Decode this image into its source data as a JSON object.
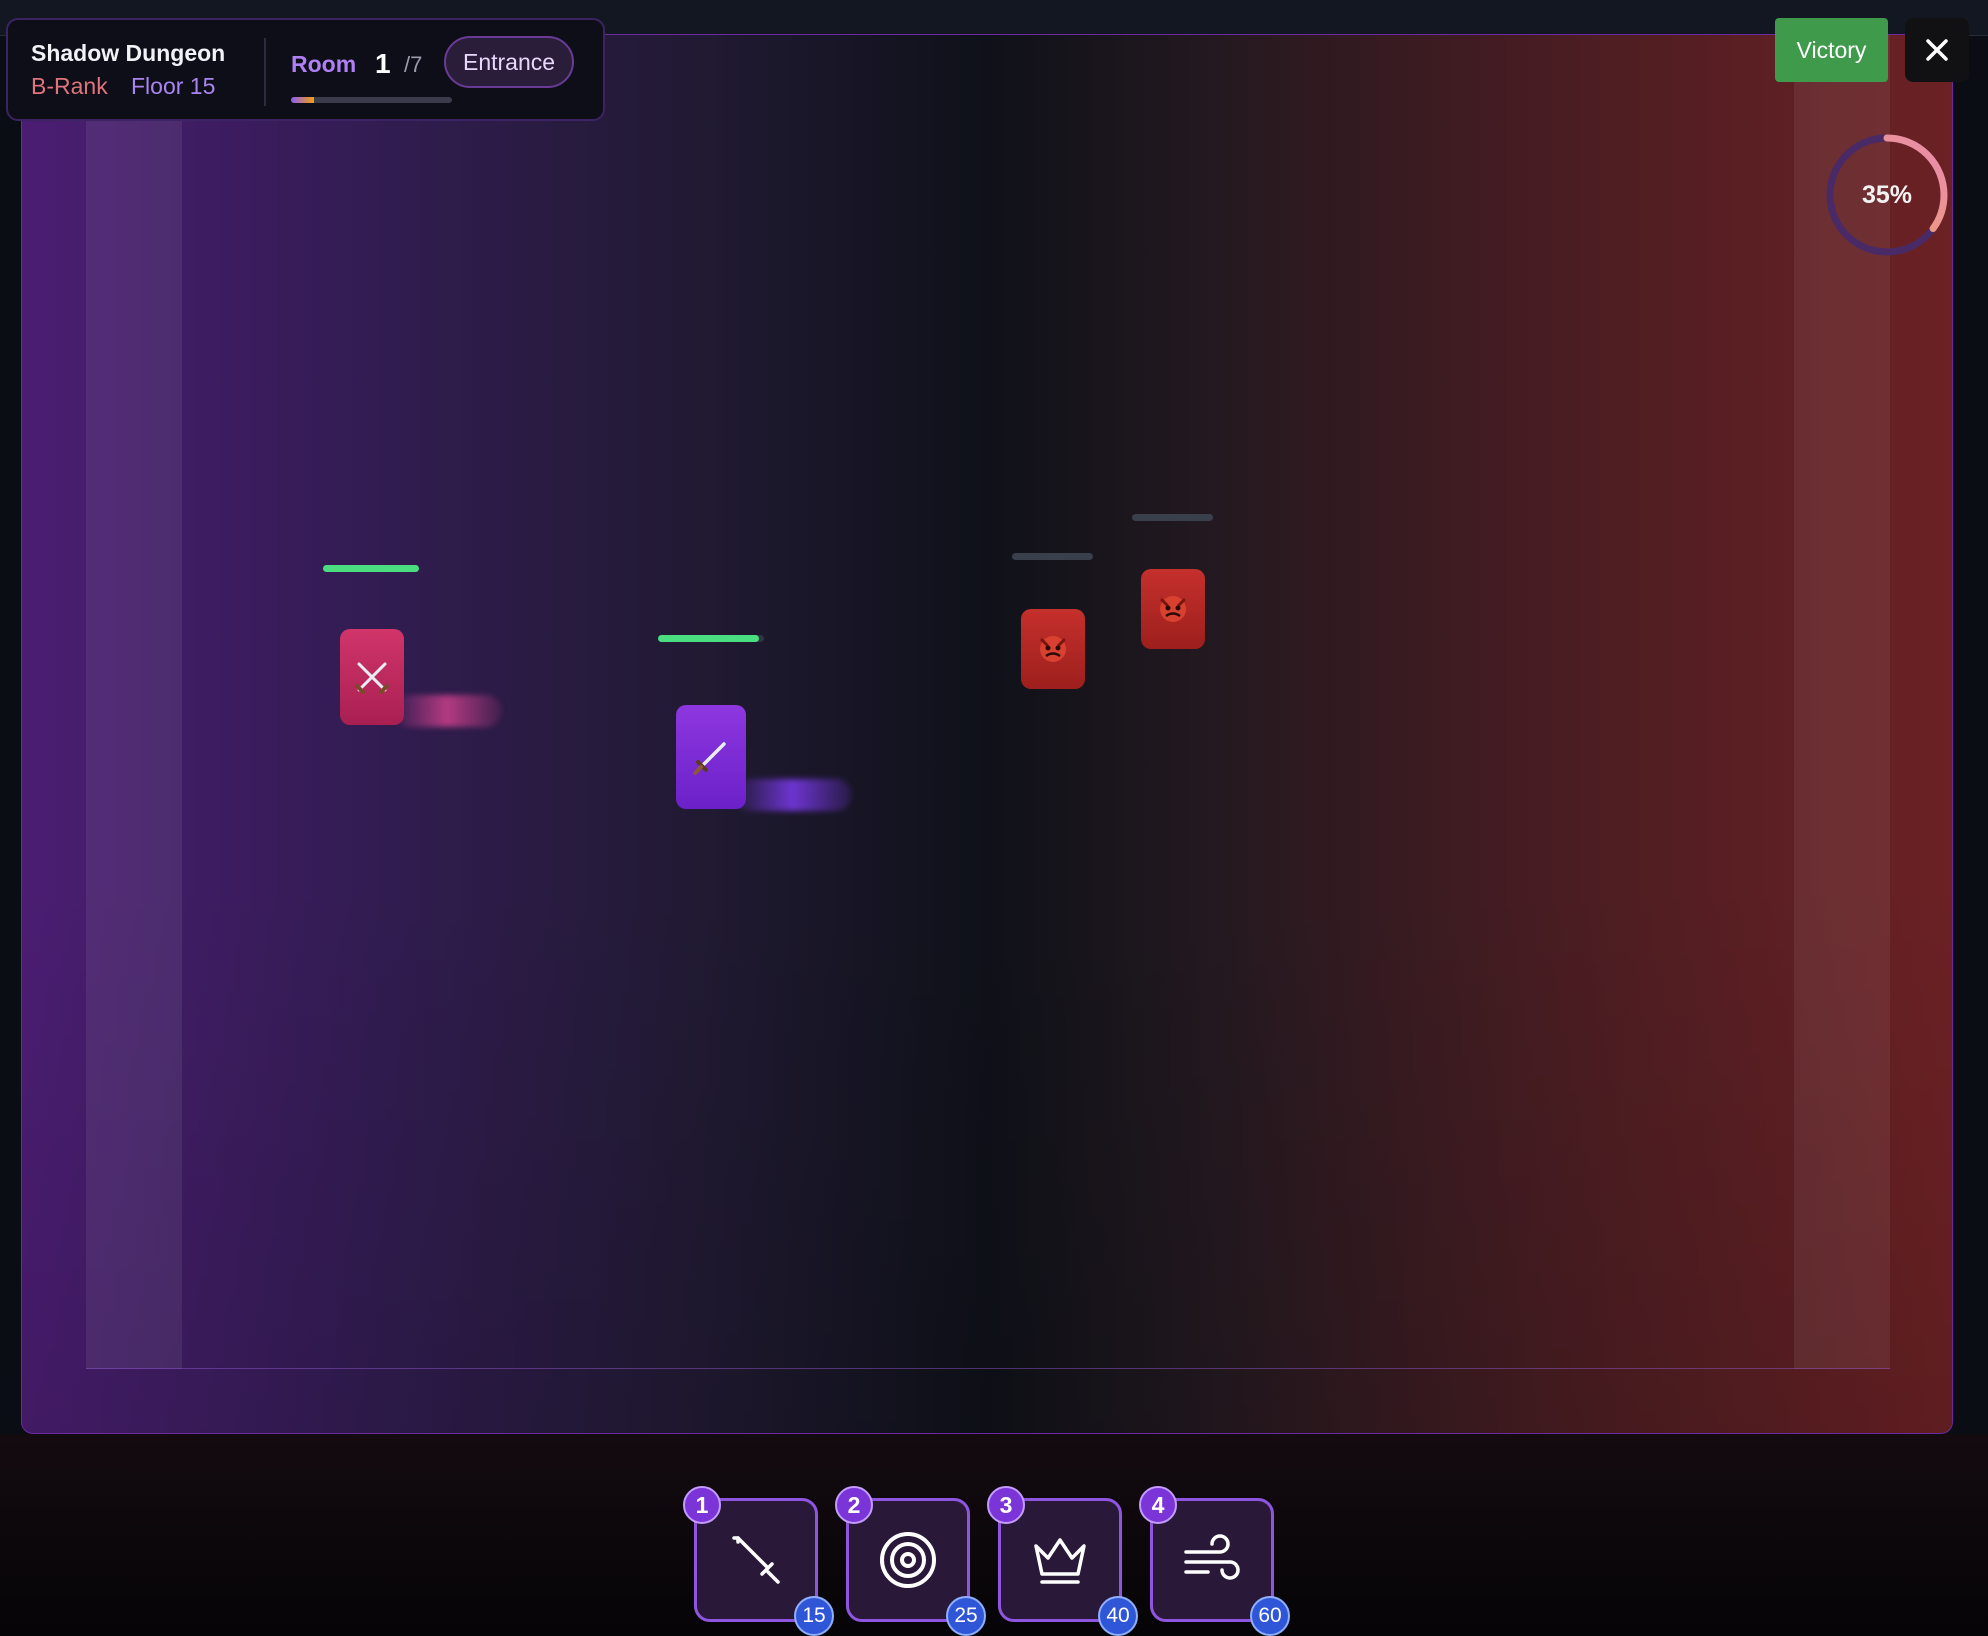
{
  "hud": {
    "dungeon_name": "Shadow Dungeon",
    "rank": "B-Rank",
    "floor": "Floor 15",
    "room_label": "Room",
    "room_current": "1",
    "room_total": "/7",
    "room_name": "Entrance",
    "room_progress": 0.14
  },
  "controls": {
    "victory_label": "Victory",
    "close_icon": "close-icon"
  },
  "gate": {
    "percent_label": "35%",
    "percent_value": 35
  },
  "units": {
    "heroes": [
      {
        "name": "swordsman",
        "icon": "crossed-swords-icon",
        "hp": 1.0
      },
      {
        "name": "assassin",
        "icon": "dagger-icon",
        "hp": 0.95
      }
    ],
    "enemies": [
      {
        "name": "goblin-1",
        "icon": "goblin-icon",
        "hp": 0
      },
      {
        "name": "goblin-2",
        "icon": "goblin-icon",
        "hp": 0
      }
    ]
  },
  "skills": [
    {
      "key": "1",
      "icon": "sword-icon",
      "cost": "15"
    },
    {
      "key": "2",
      "icon": "target-icon",
      "cost": "25"
    },
    {
      "key": "3",
      "icon": "crown-icon",
      "cost": "40"
    },
    {
      "key": "4",
      "icon": "wind-icon",
      "cost": "60"
    }
  ],
  "colors": {
    "accent": "#8b5cf6",
    "hp": "#4ade80",
    "victory": "#3f9b4b",
    "enemy": "#b91c1c",
    "mana": "#3056d8"
  }
}
